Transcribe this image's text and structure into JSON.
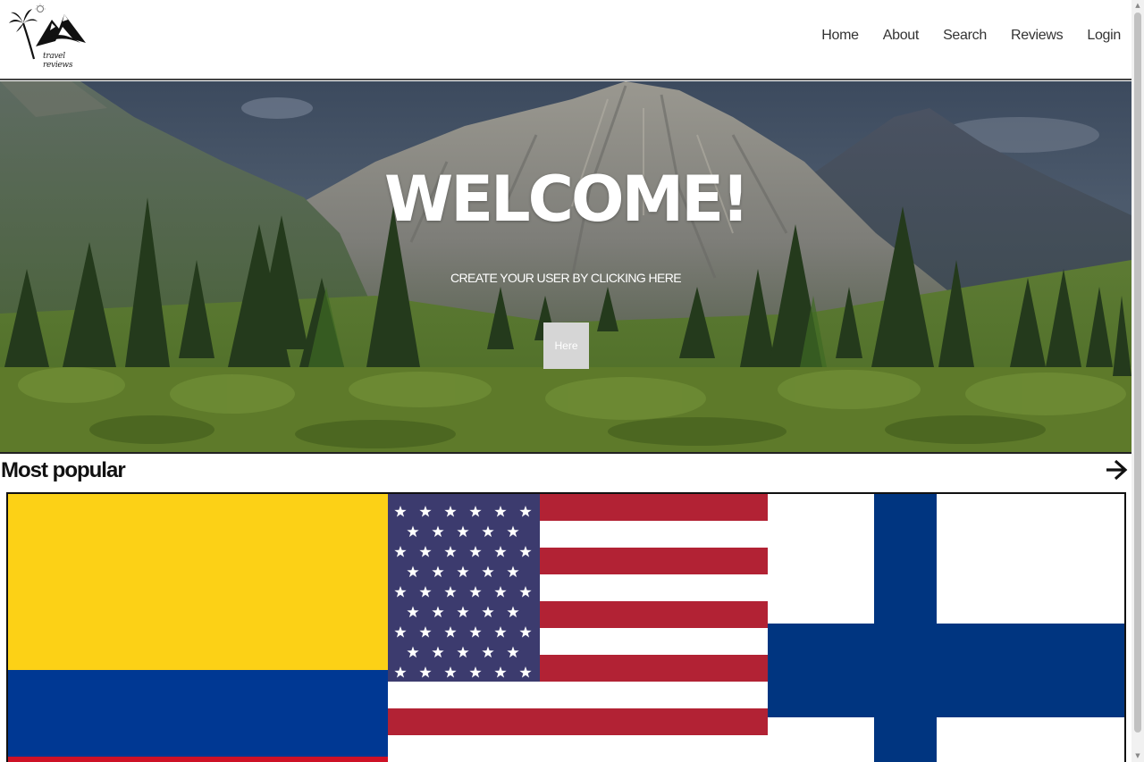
{
  "brand": {
    "logo_text": "travel reviews"
  },
  "nav": {
    "items": [
      {
        "label": "Home"
      },
      {
        "label": "About"
      },
      {
        "label": "Search"
      },
      {
        "label": "Reviews"
      },
      {
        "label": "Login"
      }
    ]
  },
  "hero": {
    "title": "WELCOME!",
    "subtitle": "CREATE YOUR USER BY CLICKING HERE",
    "button_label": "Here"
  },
  "popular": {
    "title": "Most popular",
    "arrow_icon": "arrow-right-icon",
    "flags": [
      {
        "icon": "colombia-flag-icon"
      },
      {
        "icon": "usa-flag-icon"
      },
      {
        "icon": "finland-flag-icon"
      }
    ]
  },
  "colors": {
    "colombia_yellow": "#FCD116",
    "colombia_blue": "#003893",
    "colombia_red": "#CE1126",
    "usa_red": "#B22234",
    "usa_blue": "#3C3B6E",
    "finland_blue": "#003580"
  }
}
